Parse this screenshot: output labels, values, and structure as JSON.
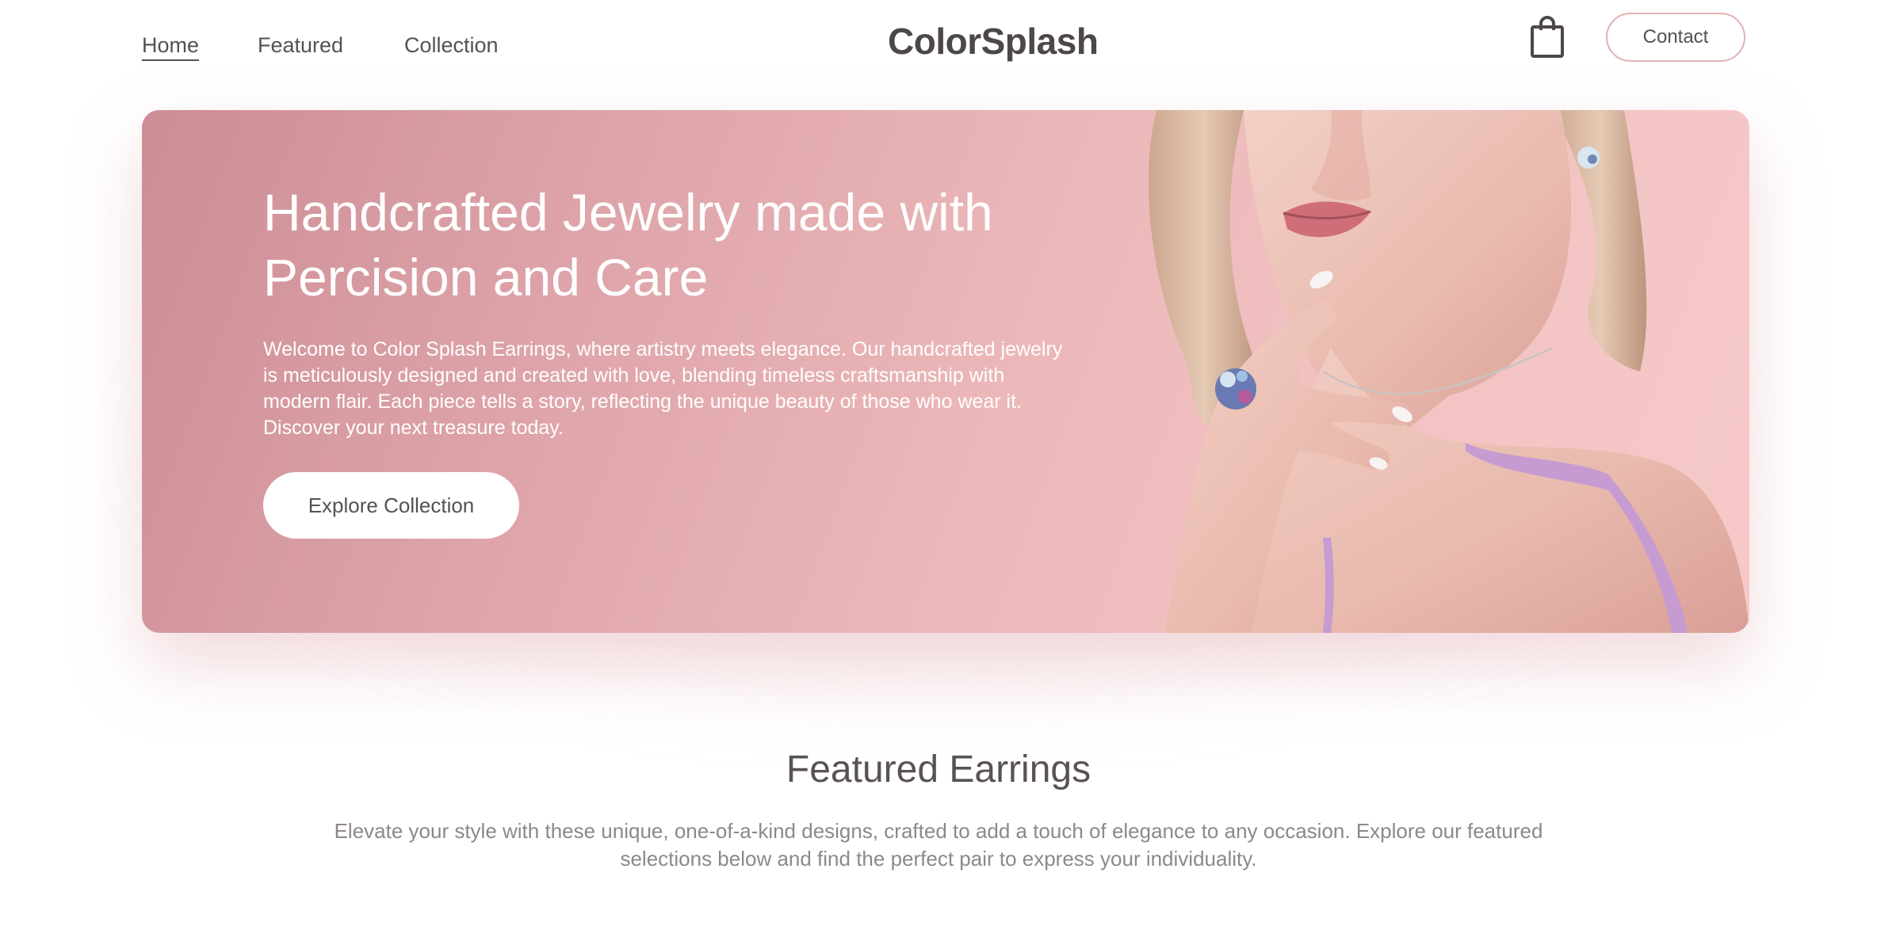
{
  "nav": {
    "links": [
      {
        "label": "Home",
        "active": true
      },
      {
        "label": "Featured",
        "active": false
      },
      {
        "label": "Collection",
        "active": false
      }
    ],
    "logo": "ColorSplash",
    "cart_icon": "shopping-bag-icon",
    "contact_label": "Contact"
  },
  "hero": {
    "title": "Handcrafted Jewelry made with Percision and Care",
    "description": "Welcome to Color Splash Earrings, where artistry meets elegance. Our handcrafted jewelry is meticulously designed and created with love, blending timeless craftsmanship with modern flair. Each piece tells a story, reflecting the unique beauty of those who wear it. Discover your next treasure today.",
    "cta_label": "Explore Collection",
    "image": "woman-wearing-jewelry-photo"
  },
  "featured": {
    "title": "Featured Earrings",
    "description": "Elevate your style with these unique, one-of-a-kind designs, crafted to add a touch of elegance to any occasion. Explore our featured selections below and find the perfect pair to express your individuality."
  },
  "colors": {
    "hero_gradient_start": "#cd8d95",
    "hero_gradient_end": "#f6c9c9",
    "contact_border": "#e2b2b3",
    "text_dark": "#4d4747",
    "text_muted": "#8e8888"
  }
}
